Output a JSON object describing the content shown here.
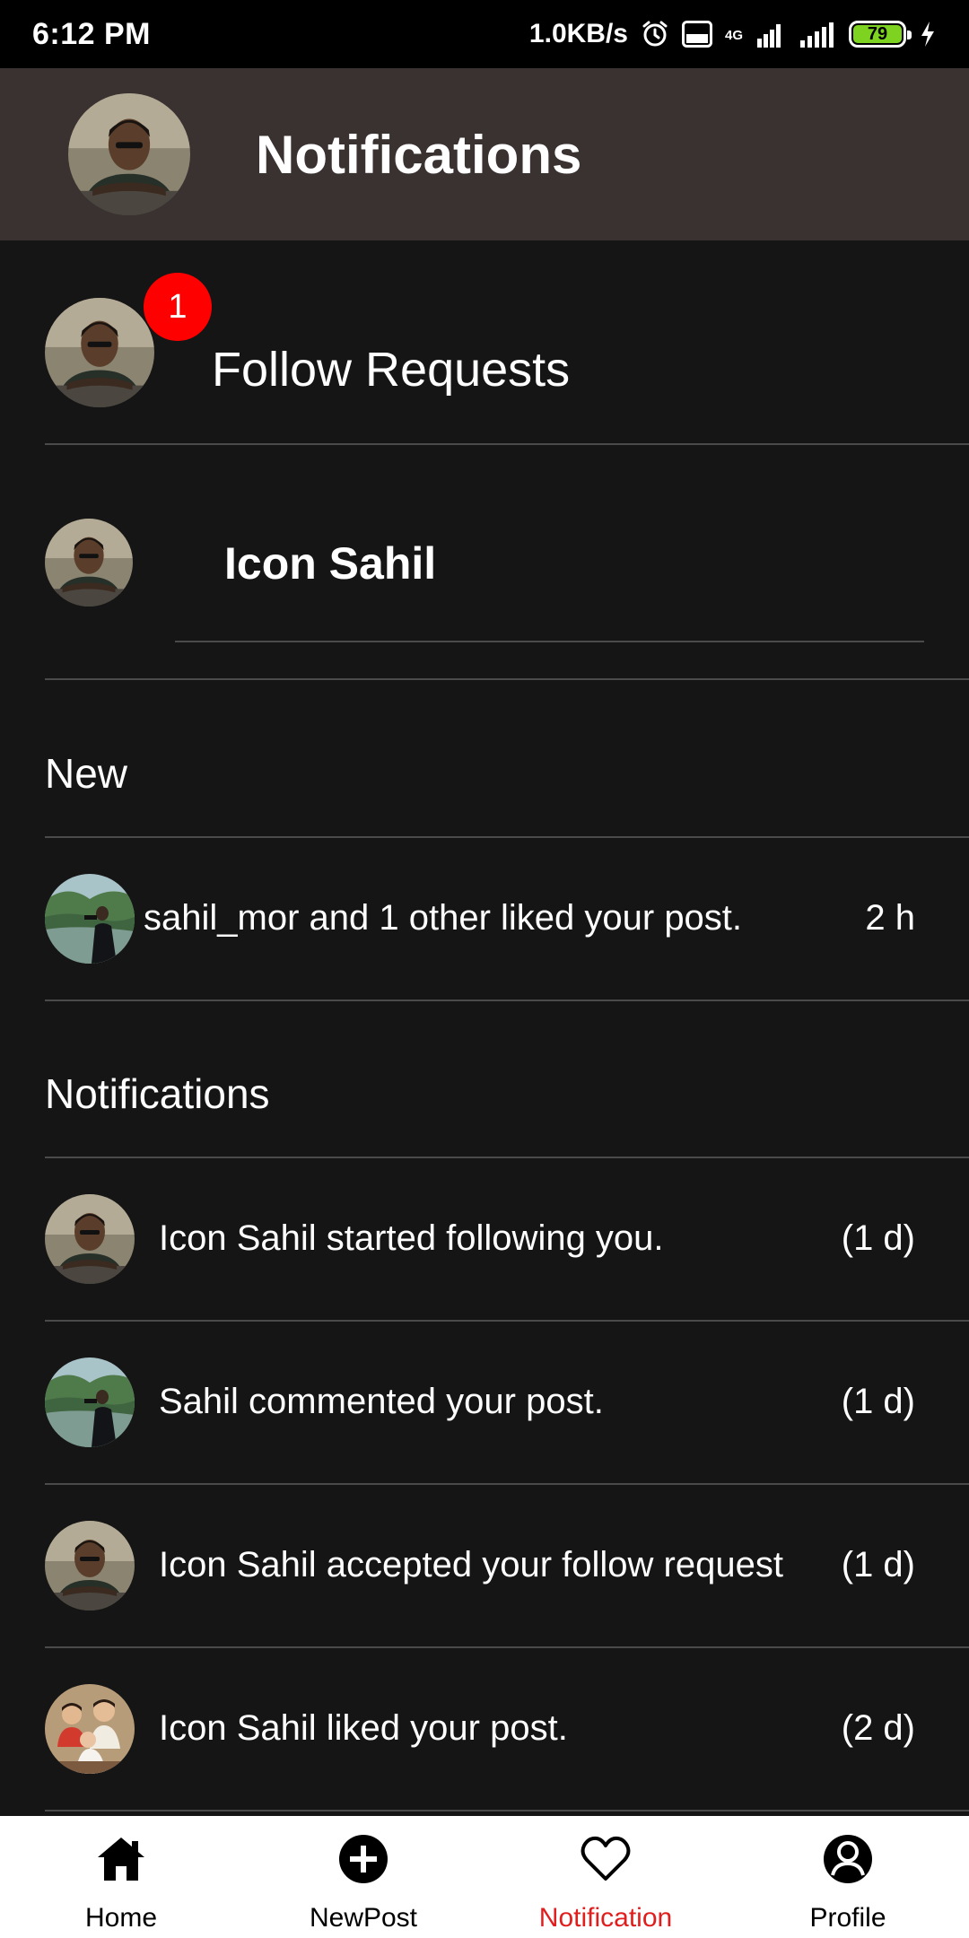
{
  "status_bar": {
    "time": "6:12 PM",
    "net_speed": "1.0KB/s",
    "network": "4G",
    "battery": "79"
  },
  "header": {
    "title": "Notifications"
  },
  "follow_requests": {
    "label": "Follow Requests",
    "badge_count": "1"
  },
  "suggested_user": {
    "name": "Icon Sahil"
  },
  "sections": {
    "new_title": "New",
    "notifications_title": "Notifications"
  },
  "new_items": [
    {
      "text": "sahil_mor and 1 other liked your post.",
      "time": "2 h",
      "avatar": "landscape"
    }
  ],
  "notification_items": [
    {
      "text": "Icon Sahil started following you.",
      "time": "(1 d)",
      "avatar": "portrait"
    },
    {
      "text": "Sahil commented your post.",
      "time": "(1 d)",
      "avatar": "landscape"
    },
    {
      "text": "Icon Sahil accepted your follow request",
      "time": "(1 d)",
      "avatar": "portrait"
    },
    {
      "text": "Icon Sahil liked your post.",
      "time": "(2 d)",
      "avatar": "family"
    }
  ],
  "bottom_nav": [
    {
      "label": "Home",
      "icon": "home-icon",
      "active": false
    },
    {
      "label": "NewPost",
      "icon": "add-circle-icon",
      "active": false
    },
    {
      "label": "Notification",
      "icon": "heart-icon",
      "active": true
    },
    {
      "label": "Profile",
      "icon": "profile-icon",
      "active": false
    }
  ],
  "colors": {
    "background": "#161516",
    "header": "#3a3131",
    "badge": "#ff0000",
    "active_nav": "#e01e1e"
  }
}
